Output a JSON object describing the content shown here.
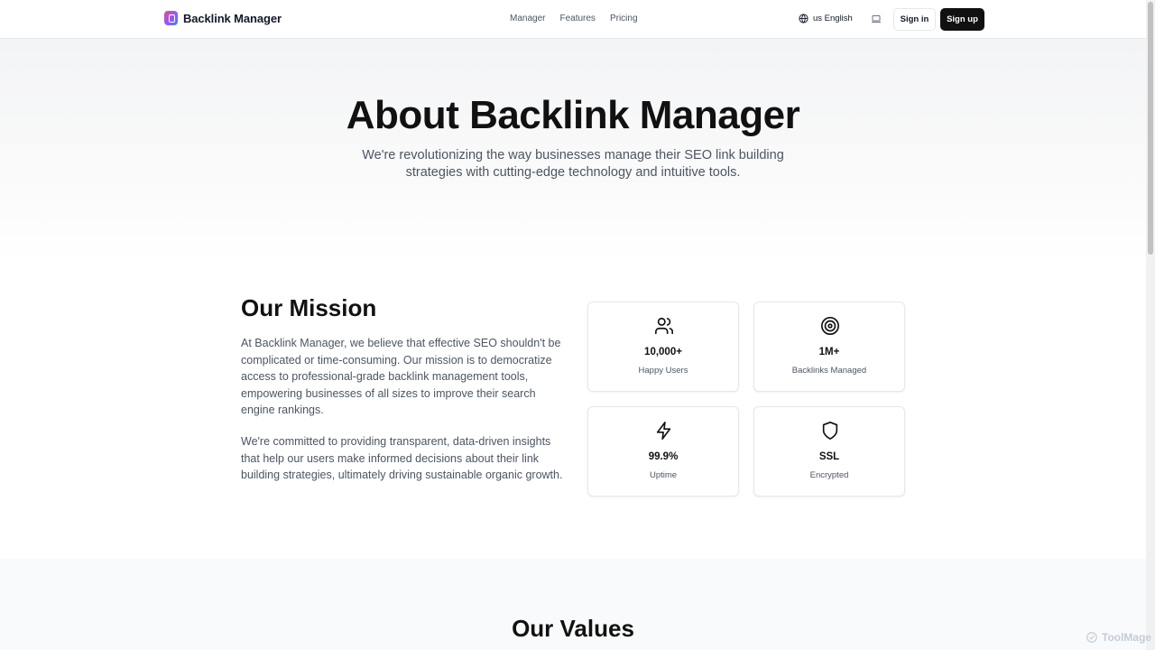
{
  "header": {
    "brand_name": "Backlink Manager",
    "nav": [
      "Manager",
      "Features",
      "Pricing"
    ],
    "language": "us English",
    "sign_in": "Sign in",
    "sign_up": "Sign up"
  },
  "hero": {
    "title": "About Backlink Manager",
    "subtitle": "We're revolutionizing the way businesses manage their SEO link building strategies with cutting-edge technology and intuitive tools."
  },
  "mission": {
    "title": "Our Mission",
    "paragraph_1": "At Backlink Manager, we believe that effective SEO shouldn't be complicated or time-consuming. Our mission is to democratize access to professional-grade backlink management tools, empowering businesses of all sizes to improve their search engine rankings.",
    "paragraph_2": "We're committed to providing transparent, data-driven insights that help our users make informed decisions about their link building strategies, ultimately driving sustainable organic growth.",
    "stats": [
      {
        "icon": "users-icon",
        "value": "10,000+",
        "label": "Happy Users"
      },
      {
        "icon": "target-icon",
        "value": "1M+",
        "label": "Backlinks Managed"
      },
      {
        "icon": "zap-icon",
        "value": "99.9%",
        "label": "Uptime"
      },
      {
        "icon": "shield-icon",
        "value": "SSL",
        "label": "Encrypted"
      }
    ]
  },
  "values": {
    "title": "Our Values"
  },
  "watermark": "ToolMage",
  "colors": {
    "primary_button": "#111111",
    "text_dark": "#111111",
    "text_muted": "#4b5563",
    "border": "#e5e7eb"
  }
}
